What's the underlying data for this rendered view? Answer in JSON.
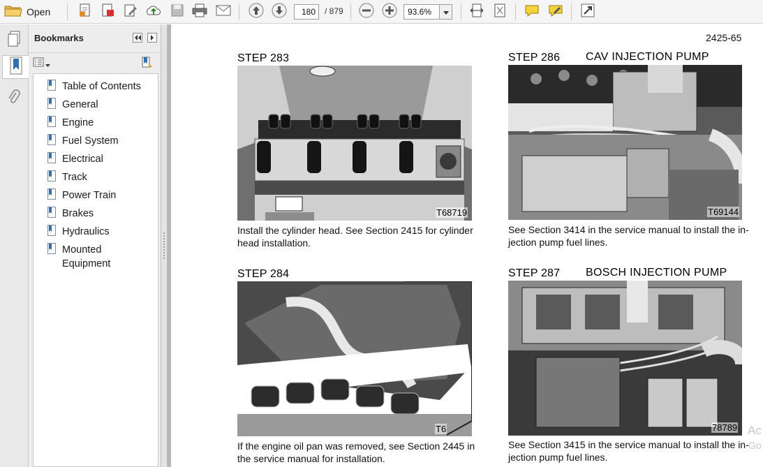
{
  "toolbar": {
    "open_label": "Open",
    "page_current": "180",
    "page_total": "/ 879",
    "zoom_value": "93.6%"
  },
  "navstrip": {
    "items": [
      "pages-icon",
      "bookmarks-icon",
      "attachments-icon"
    ]
  },
  "bookmarks": {
    "title": "Bookmarks",
    "items": [
      {
        "label": "Table of Contents"
      },
      {
        "label": "General"
      },
      {
        "label": "Engine"
      },
      {
        "label": "Fuel System"
      },
      {
        "label": "Electrical"
      },
      {
        "label": "Track"
      },
      {
        "label": "Power Train"
      },
      {
        "label": "Brakes"
      },
      {
        "label": "Hydraulics"
      },
      {
        "label": "Mounted",
        "label2": "Equipment"
      }
    ]
  },
  "document": {
    "page_number": "2425-65",
    "steps": [
      {
        "heading": "STEP 283",
        "subheading": "",
        "photo_code": "T68719",
        "caption_line1": "Install the cylinder head. See Section 2415 for cylinder",
        "caption_line2": "head installation."
      },
      {
        "heading": "STEP 286",
        "subheading": "CAV INJECTION PUMP",
        "photo_code": "T69144",
        "caption_line1": "See Section 3414 in the service manual to install the in-",
        "caption_line2": "jection pump fuel lines."
      },
      {
        "heading": "STEP 284",
        "subheading": "",
        "photo_code": "T6",
        "caption_line1": "If the engine oil pan was removed, see Section 2445 in",
        "caption_line2": "the service manual for installation."
      },
      {
        "heading": "STEP 287",
        "subheading": "BOSCH INJECTION PUMP",
        "photo_code": "78789",
        "caption_line1": "See Section 3415 in the service manual to install the in-",
        "caption_line2": "jection pump fuel lines."
      }
    ],
    "watermark_line1": "Ac",
    "watermark_line2": "Go"
  }
}
